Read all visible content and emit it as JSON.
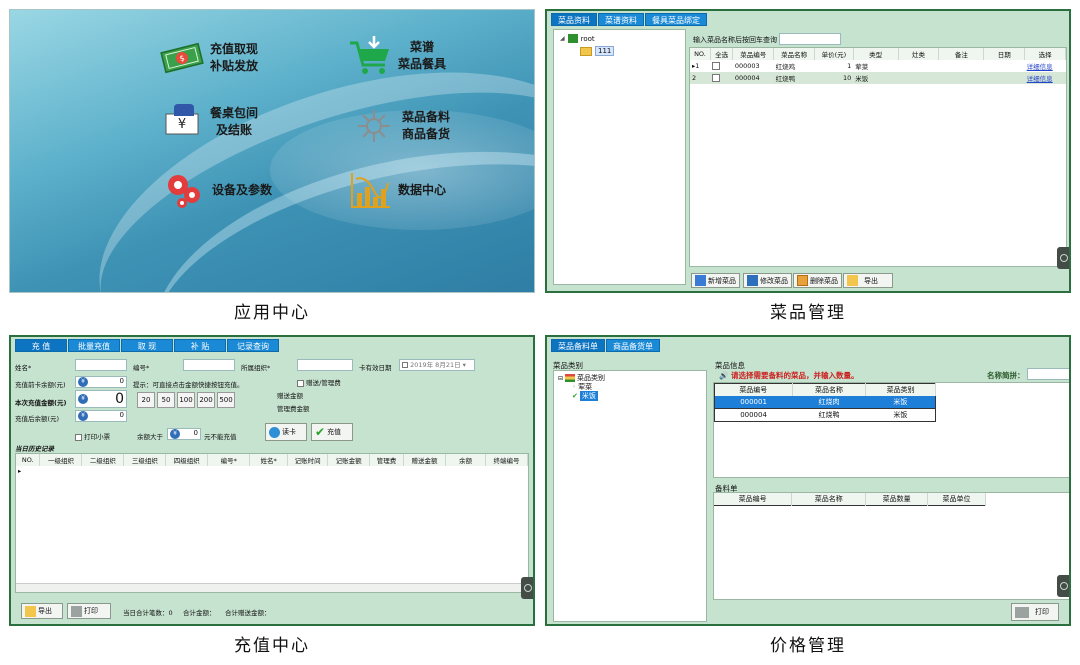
{
  "captions": {
    "app_center": "应用中心",
    "dish_management": "菜品管理",
    "recharge_center": "充值中心",
    "price_management": "价格管理"
  },
  "app_center": {
    "tiles": [
      {
        "line1": "充值取现",
        "line2": "补贴发放",
        "icon": "money-icon"
      },
      {
        "line1": "菜谱",
        "line2": "菜品餐具",
        "icon": "shopping-cart-icon"
      },
      {
        "line1": "餐桌包间",
        "line2": "及结账",
        "icon": "payment-hand-icon"
      },
      {
        "line1": "菜品备料",
        "line2": "商品备货",
        "icon": "ingredients-icon"
      },
      {
        "line1": "设备及参数",
        "line2": "",
        "icon": "gears-icon"
      },
      {
        "line1": "数据中心",
        "line2": "",
        "icon": "bar-chart-icon"
      }
    ]
  },
  "dish": {
    "tabs": [
      "菜品资料",
      "菜谱资料",
      "餐具菜品绑定"
    ],
    "tree": {
      "root": "root",
      "child": "111"
    },
    "search_label": "输入菜品名称后按回车查询",
    "search_value": "",
    "columns": [
      "NO.",
      "全选",
      "菜品编号",
      "菜品名称",
      "单价(元)",
      "类型",
      "灶类",
      "备注",
      "日期",
      "选择"
    ],
    "rows": [
      {
        "no": "1",
        "code": "000003",
        "name": "红烧鸡",
        "price": "1",
        "type": "荤菜",
        "stove": "",
        "note": "",
        "date": "",
        "action": "详细信息"
      },
      {
        "no": "2",
        "code": "000004",
        "name": "红烧鸭",
        "price": "10",
        "type": "米饭",
        "stove": "",
        "note": "",
        "date": "",
        "action": "详细信息"
      }
    ],
    "buttons": {
      "add": "新增菜品",
      "edit": "修改菜品",
      "delete": "删除菜品",
      "export": "导出"
    }
  },
  "recharge": {
    "tabs": [
      "充 值",
      "批量充值",
      "取 现",
      "补 贴",
      "记录查询"
    ],
    "labels": {
      "name": "姓名*",
      "number": "编号*",
      "org": "所属组织*",
      "card_valid": "卡有效日期",
      "balance_before": "充值前卡余额(元)",
      "amount": "本次充值金额(元)",
      "balance_after": "充值后余额(元)",
      "hint": "提示：可直接点击金额快捷按钮充值。",
      "gift_fee": "赠送/管理费",
      "gift_amount": "赠送金额",
      "mgmt_fee": "管理费金额",
      "print_receipt": "打印小票",
      "balance_gt": "余额大于",
      "no_recharge": "元不能充值",
      "history": "当日历史记录"
    },
    "values": {
      "card_date": "2019年  8月21日",
      "balance_before": "0",
      "amount": "0",
      "balance_after": "0",
      "limit": "0"
    },
    "quick_amounts": [
      "20",
      "50",
      "100",
      "200",
      "500"
    ],
    "buttons": {
      "read_card": "读卡",
      "recharge": "充值",
      "export": "导出",
      "print": "打印"
    },
    "columns": [
      "NO.",
      "一级组织",
      "二级组织",
      "三级组织",
      "四级组织",
      "编号*",
      "姓名*",
      "记账时间",
      "记账金额",
      "管理费",
      "赠送金额",
      "余额",
      "终端编号"
    ],
    "footer": {
      "count": "当日合计笔数：0",
      "total": "合计金额：",
      "gift_total": "合计赠送金额："
    }
  },
  "price": {
    "tabs": [
      "菜品备料单",
      "商品备货单"
    ],
    "category_title": "菜品类别",
    "tree": {
      "root": "菜品类别",
      "child1": "荤菜",
      "child2": "米饭"
    },
    "info_title": "菜品信息",
    "warning": "请选择需要备料的菜品，并输入数量。",
    "search_label": "名称简拼：",
    "columns": [
      "菜品编号",
      "菜品名称",
      "菜品类别"
    ],
    "rows": [
      {
        "code": "000001",
        "name": "红烧肉",
        "cat": "米饭"
      },
      {
        "code": "000004",
        "name": "红烧鸭",
        "cat": "米饭"
      }
    ],
    "prep_title": "备料单",
    "prep_columns": [
      "菜品编号",
      "菜品名称",
      "菜品数量",
      "菜品单位"
    ],
    "buttons": {
      "print": "打印"
    }
  }
}
